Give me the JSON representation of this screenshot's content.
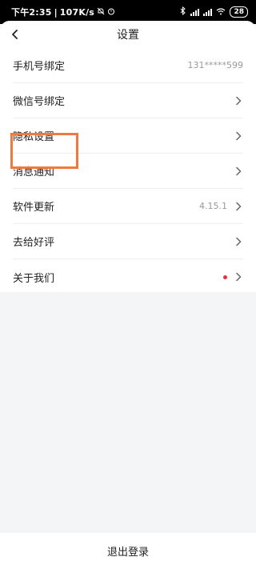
{
  "status_bar": {
    "time": "下午2:35",
    "speed": "107K/s",
    "battery": "28"
  },
  "header": {
    "title": "设置"
  },
  "settings": [
    {
      "label": "手机号绑定",
      "value": "131*****599",
      "chevron": false,
      "dot": false
    },
    {
      "label": "微信号绑定",
      "value": "",
      "chevron": true,
      "dot": false
    },
    {
      "label": "隐私设置",
      "value": "",
      "chevron": true,
      "dot": false
    },
    {
      "label": "消息通知",
      "value": "",
      "chevron": true,
      "dot": false
    },
    {
      "label": "软件更新",
      "value": "4.15.1",
      "chevron": true,
      "dot": false
    },
    {
      "label": "去给好评",
      "value": "",
      "chevron": true,
      "dot": false
    },
    {
      "label": "关于我们",
      "value": "",
      "chevron": true,
      "dot": true
    }
  ],
  "footer": {
    "logout_label": "退出登录"
  },
  "colors": {
    "highlight": "#f07a3e",
    "dot": "#e8303a",
    "background": "#f4f5f7"
  }
}
